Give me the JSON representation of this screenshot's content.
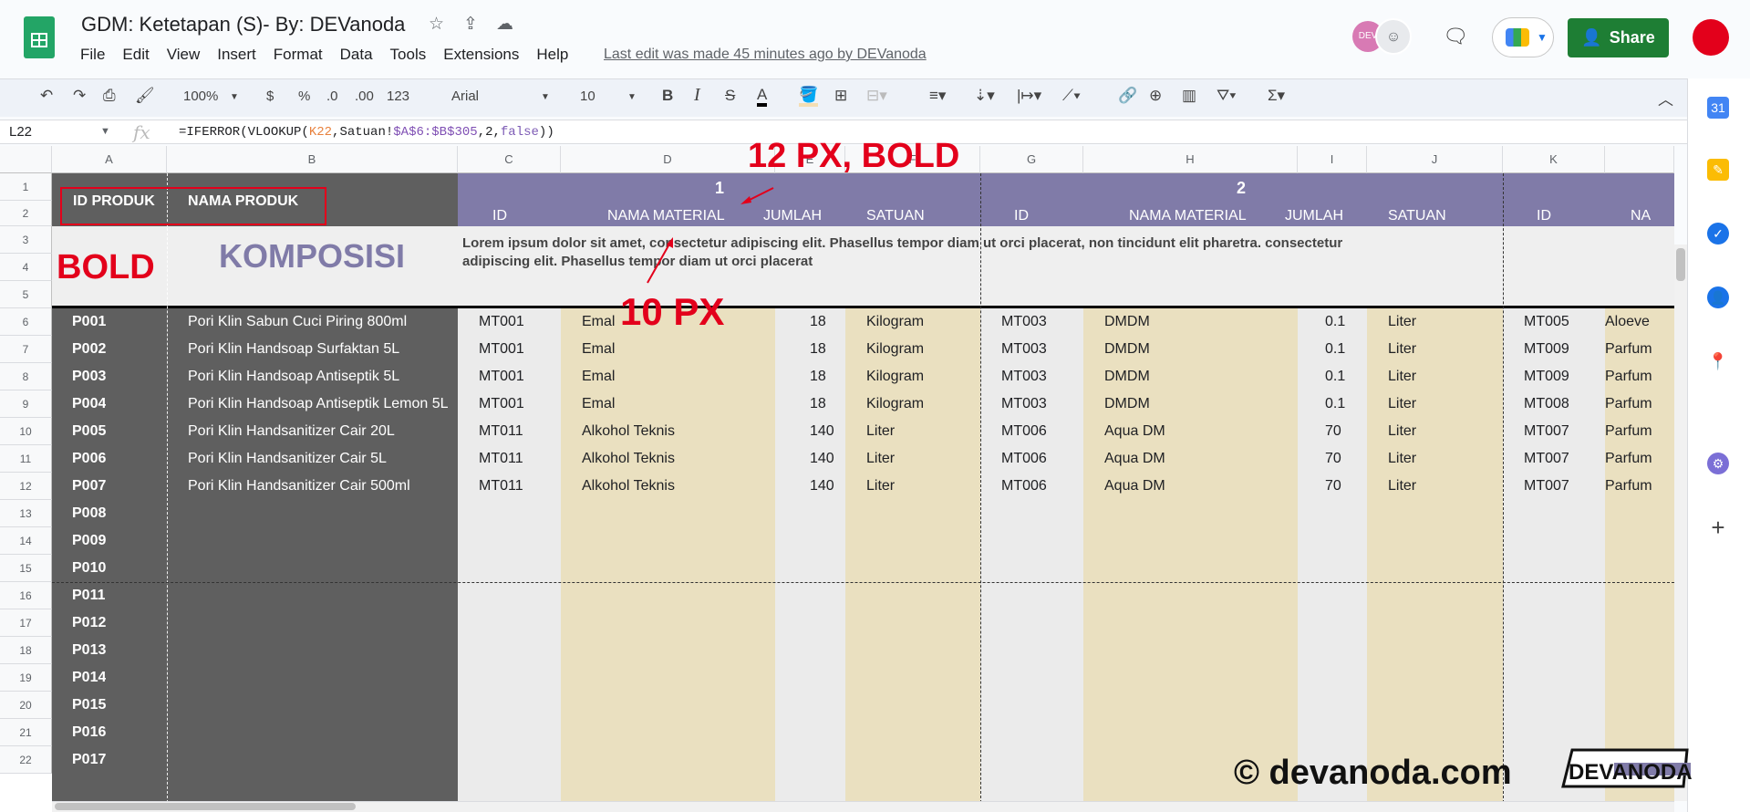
{
  "header": {
    "title": "GDM: Ketetapan (S)- By: DEVanoda",
    "last_edit": "Last edit was made 45 minutes ago by DEVanoda",
    "share_label": "Share",
    "avatar_label": "DEV"
  },
  "menu": [
    "File",
    "Edit",
    "View",
    "Insert",
    "Format",
    "Data",
    "Tools",
    "Extensions",
    "Help"
  ],
  "toolbar": {
    "zoom": "100%",
    "currency": "$",
    "percent": "%",
    "dec_decrease": ".0",
    "dec_increase": ".00",
    "number_format": "123",
    "font": "Arial",
    "font_size": "10",
    "bold": "B",
    "italic": "I",
    "strike": "S",
    "text_color": "A",
    "sum": "Σ"
  },
  "formula_bar": {
    "cell_ref": "L22",
    "fx": "fx",
    "formula_parts": [
      "=IFERROR(VLOOKUP(",
      "K22",
      ",Satuan!",
      "$A$6:$B$305",
      ",2,",
      "false",
      "))"
    ]
  },
  "columns": [
    "A",
    "B",
    "C",
    "D",
    "E",
    "F",
    "G",
    "H",
    "I",
    "J",
    "K"
  ],
  "rows": [
    "1",
    "2",
    "3",
    "4",
    "5",
    "6",
    "7",
    "8",
    "9",
    "10",
    "11",
    "12",
    "13",
    "14",
    "15",
    "16",
    "17",
    "18",
    "19",
    "20",
    "21",
    "22"
  ],
  "sheet": {
    "id_produk": "ID PRODUK",
    "nama_produk": "NAMA PRODUK",
    "groups": [
      "1",
      "2"
    ],
    "sub": {
      "id": "ID",
      "nama": "NAMA MATERIAL",
      "jumlah": "JUMLAH",
      "satuan": "SATUAN",
      "na": "NA"
    },
    "komposisi": "KOMPOSISI",
    "lorem_1": "Lorem ipsum dolor sit amet, consectetur adipiscing elit. Phasellus tempor diam ut orci placerat, non tincidunt elit pharetra. consectetur",
    "lorem_2": "adipiscing elit. Phasellus tempor diam ut orci placerat",
    "data": [
      {
        "id": "P001",
        "nama": "Pori Klin Sabun Cuci Piring 800ml",
        "m1": "MT001",
        "n1": "Emal",
        "j1": "18",
        "s1": "Kilogram",
        "m2": "MT003",
        "n2": "DMDM",
        "j2": "0.1",
        "s2": "Liter",
        "m3": "MT005",
        "n3": "Aloeve"
      },
      {
        "id": "P002",
        "nama": "Pori Klin Handsoap Surfaktan 5L",
        "m1": "MT001",
        "n1": "Emal",
        "j1": "18",
        "s1": "Kilogram",
        "m2": "MT003",
        "n2": "DMDM",
        "j2": "0.1",
        "s2": "Liter",
        "m3": "MT009",
        "n3": "Parfum"
      },
      {
        "id": "P003",
        "nama": "Pori Klin Handsoap Antiseptik 5L",
        "m1": "MT001",
        "n1": "Emal",
        "j1": "18",
        "s1": "Kilogram",
        "m2": "MT003",
        "n2": "DMDM",
        "j2": "0.1",
        "s2": "Liter",
        "m3": "MT009",
        "n3": "Parfum"
      },
      {
        "id": "P004",
        "nama": "Pori Klin Handsoap Antiseptik Lemon 5L",
        "m1": "MT001",
        "n1": "Emal",
        "j1": "18",
        "s1": "Kilogram",
        "m2": "MT003",
        "n2": "DMDM",
        "j2": "0.1",
        "s2": "Liter",
        "m3": "MT008",
        "n3": "Parfum"
      },
      {
        "id": "P005",
        "nama": "Pori Klin Handsanitizer Cair 20L",
        "m1": "MT011",
        "n1": "Alkohol Teknis",
        "j1": "140",
        "s1": "Liter",
        "m2": "MT006",
        "n2": "Aqua DM",
        "j2": "70",
        "s2": "Liter",
        "m3": "MT007",
        "n3": "Parfum"
      },
      {
        "id": "P006",
        "nama": "Pori Klin Handsanitizer Cair 5L",
        "m1": "MT011",
        "n1": "Alkohol Teknis",
        "j1": "140",
        "s1": "Liter",
        "m2": "MT006",
        "n2": "Aqua DM",
        "j2": "70",
        "s2": "Liter",
        "m3": "MT007",
        "n3": "Parfum"
      },
      {
        "id": "P007",
        "nama": "Pori Klin Handsanitizer Cair 500ml",
        "m1": "MT011",
        "n1": "Alkohol Teknis",
        "j1": "140",
        "s1": "Liter",
        "m2": "MT006",
        "n2": "Aqua DM",
        "j2": "70",
        "s2": "Liter",
        "m3": "MT007",
        "n3": "Parfum"
      },
      {
        "id": "P008"
      },
      {
        "id": "P009"
      },
      {
        "id": "P010"
      },
      {
        "id": "P011"
      },
      {
        "id": "P012"
      },
      {
        "id": "P013"
      },
      {
        "id": "P014"
      },
      {
        "id": "P015"
      },
      {
        "id": "P016"
      },
      {
        "id": "P017"
      }
    ]
  },
  "annotations": {
    "twelve": "12 PX, BOLD",
    "bold": "BOLD",
    "ten": "10 PX"
  },
  "watermark": {
    "text": "© devanoda.com",
    "logo": "DEVANODA"
  },
  "colors": {
    "dark": "#5f5f5f",
    "purple": "#807ba8",
    "beige": "#eae0c0",
    "share": "#1e7e34",
    "annotation": "#e3001b"
  }
}
